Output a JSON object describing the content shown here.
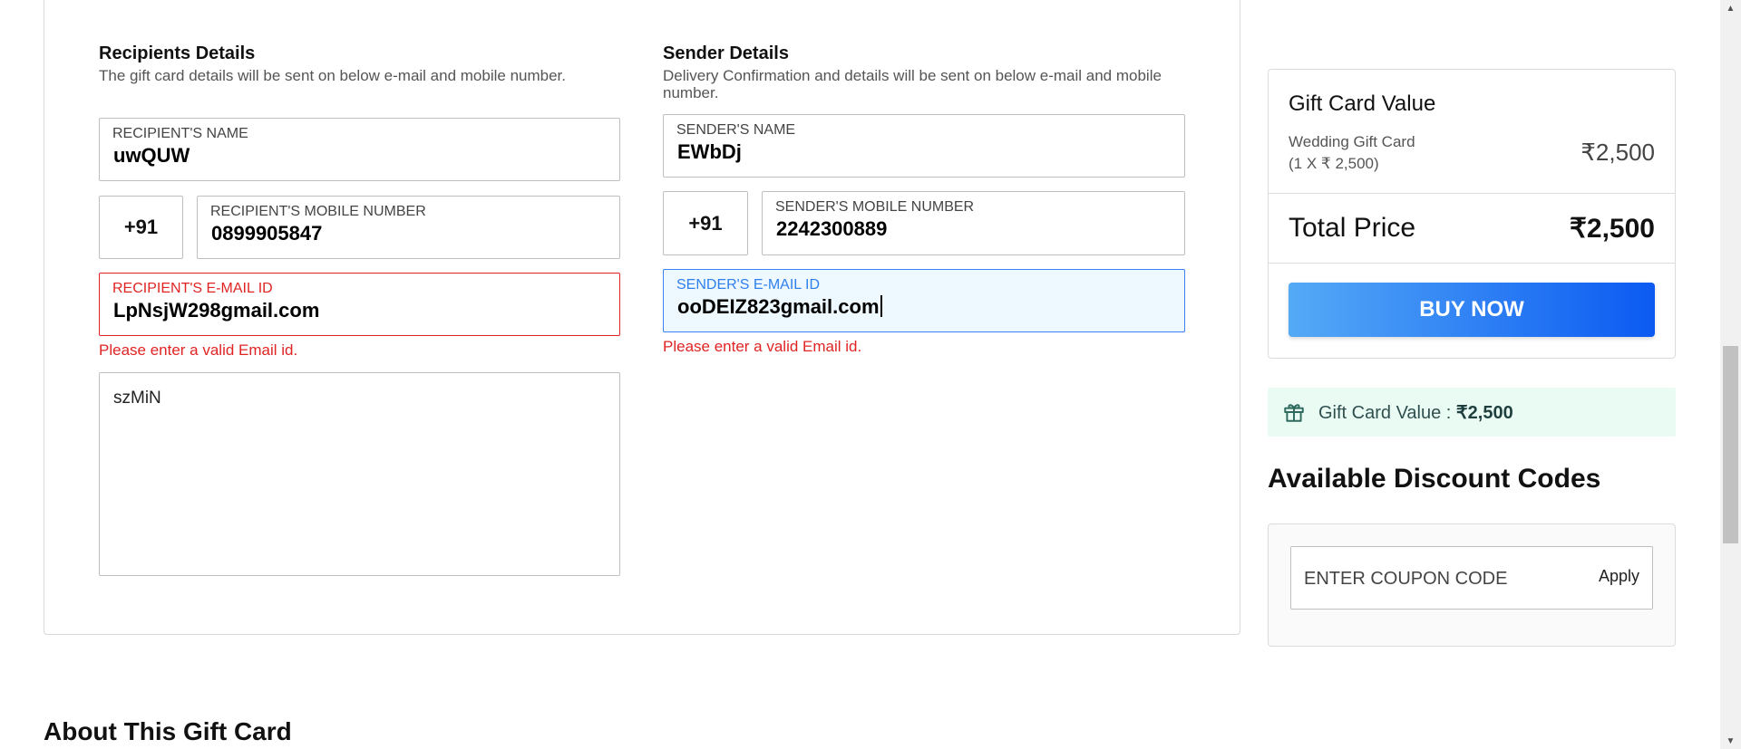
{
  "recipient": {
    "title": "Recipients Details",
    "subtitle": "The gift card details will be sent on below e-mail and mobile number.",
    "name_label": "RECIPIENT'S NAME",
    "name_value": "uwQUW",
    "country_code": "+91",
    "mobile_label": "RECIPIENT'S MOBILE NUMBER",
    "mobile_value": "0899905847",
    "email_label": "RECIPIENT'S E-MAIL ID",
    "email_value": "LpNsjW298gmail.com",
    "email_error": "Please enter a valid Email id.",
    "message_value": "szMiN"
  },
  "sender": {
    "title": "Sender Details",
    "subtitle": "Delivery Confirmation and details will be sent on below e-mail and mobile number.",
    "name_label": "SENDER'S NAME",
    "name_value": "EWbDj",
    "country_code": "+91",
    "mobile_label": "SENDER'S MOBILE NUMBER",
    "mobile_value": "2242300889",
    "email_label": "SENDER'S E-MAIL ID",
    "email_value": "ooDEIZ823gmail.com",
    "email_error": "Please enter a valid Email id."
  },
  "summary": {
    "title": "Gift Card Value",
    "item_name": "Wedding Gift Card",
    "item_qty": "(1 X ₹ 2,500)",
    "item_price": "₹2,500",
    "total_label": "Total Price",
    "total_price": "₹2,500",
    "buy_label": "BUY NOW"
  },
  "gift_value_banner": {
    "label": "Gift Card Value :",
    "amount": "₹2,500",
    "icon": "gift-icon"
  },
  "discount": {
    "title": "Available Discount Codes",
    "coupon_placeholder": "ENTER COUPON CODE",
    "apply_label": "Apply"
  },
  "about": {
    "title": "About This Gift Card"
  },
  "colors": {
    "error": "#e02424",
    "focus": "#2f80ed",
    "buy_gradient_start": "#55aaf6",
    "buy_gradient_end": "#0c5af2",
    "banner_bg": "#eafbf4"
  }
}
